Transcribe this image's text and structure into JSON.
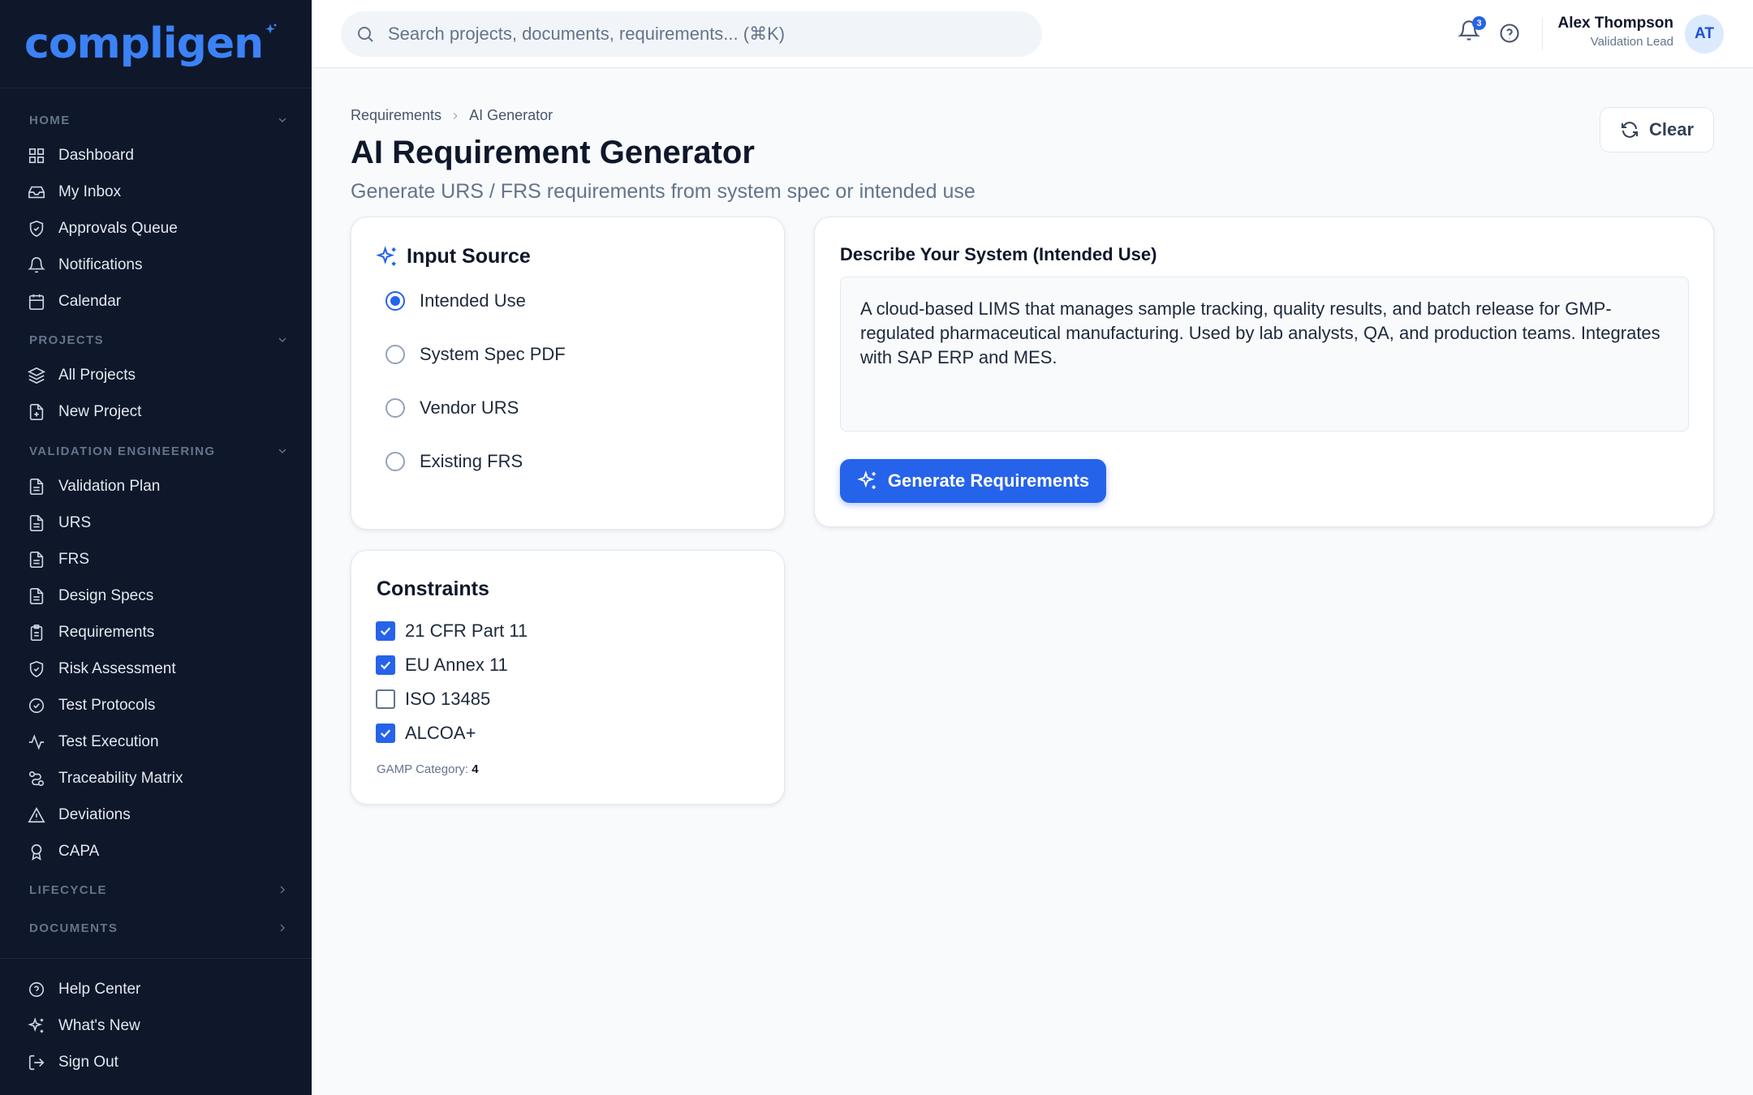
{
  "brand": {
    "name": "compligen",
    "color": "#3b82f6"
  },
  "sidebar": {
    "sections": [
      {
        "label": "HOME",
        "chevron": "chevron-down-icon"
      },
      {
        "label": "PROJECTS",
        "chevron": "chevron-down-icon"
      },
      {
        "label": "VALIDATION ENGINEERING",
        "chevron": "chevron-down-icon"
      },
      {
        "label": "LIFECYCLE",
        "chevron": "chevron-right-icon"
      },
      {
        "label": "DOCUMENTS",
        "chevron": "chevron-right-icon"
      }
    ],
    "items": [
      {
        "label": "Dashboard",
        "icon": "dashboard-icon"
      },
      {
        "label": "My Inbox",
        "icon": "inbox-icon"
      },
      {
        "label": "Approvals Queue",
        "icon": "shield-check-icon"
      },
      {
        "label": "Notifications",
        "icon": "bell-icon"
      },
      {
        "label": "Calendar",
        "icon": "calendar-icon"
      },
      {
        "label": "All Projects",
        "icon": "layers-icon"
      },
      {
        "label": "New Project",
        "icon": "file-plus-icon"
      },
      {
        "label": "Validation Plan",
        "icon": "file-text-icon"
      },
      {
        "label": "URS",
        "icon": "file-text-icon"
      },
      {
        "label": "FRS",
        "icon": "file-text-icon"
      },
      {
        "label": "Design Specs",
        "icon": "file-text-icon"
      },
      {
        "label": "Requirements",
        "icon": "clipboard-icon"
      },
      {
        "label": "Risk Assessment",
        "icon": "shield-icon"
      },
      {
        "label": "Test Protocols",
        "icon": "check-circle-icon"
      },
      {
        "label": "Test Execution",
        "icon": "activity-icon"
      },
      {
        "label": "Traceability Matrix",
        "icon": "route-icon"
      },
      {
        "label": "Deviations",
        "icon": "alert-triangle-icon"
      },
      {
        "label": "CAPA",
        "icon": "award-icon"
      }
    ],
    "footer": [
      {
        "label": "Help Center",
        "icon": "help-circle-icon"
      },
      {
        "label": "What's New",
        "icon": "sparkles-icon"
      },
      {
        "label": "Sign Out",
        "icon": "log-out-icon"
      }
    ]
  },
  "topbar": {
    "search_placeholder": "Search projects, documents, requirements... (⌘K)",
    "notification_count": "3",
    "user": {
      "name": "Alex Thompson",
      "role": "Validation Lead",
      "initials": "AT"
    }
  },
  "breadcrumb": [
    "Requirements",
    "AI Generator"
  ],
  "page": {
    "title": "AI Requirement Generator",
    "subtitle": "Generate URS / FRS requirements from system spec or intended use",
    "clear_label": "Clear"
  },
  "input_source": {
    "title": "Input Source",
    "options": [
      {
        "label": "Intended Use",
        "selected": true
      },
      {
        "label": "System Spec PDF",
        "selected": false
      },
      {
        "label": "Vendor URS",
        "selected": false
      },
      {
        "label": "Existing FRS",
        "selected": false
      }
    ]
  },
  "constraints": {
    "title": "Constraints",
    "items": [
      {
        "label": "21 CFR Part 11",
        "checked": true
      },
      {
        "label": "EU Annex 11",
        "checked": true
      },
      {
        "label": "ISO 13485",
        "checked": false
      },
      {
        "label": "ALCOA+",
        "checked": true
      }
    ],
    "gamp_label": "GAMP Category:",
    "gamp_value": "4"
  },
  "describe": {
    "label": "Describe Your System (Intended Use)",
    "value": "A cloud-based LIMS that manages sample tracking, quality results, and batch release for GMP-regulated pharmaceutical manufacturing. Used by lab analysts, QA, and production teams. Integrates with SAP ERP and MES.",
    "generate_label": "Generate Requirements"
  },
  "colors": {
    "accent": "#2563eb",
    "sidebar_bg": "#0f172a"
  }
}
